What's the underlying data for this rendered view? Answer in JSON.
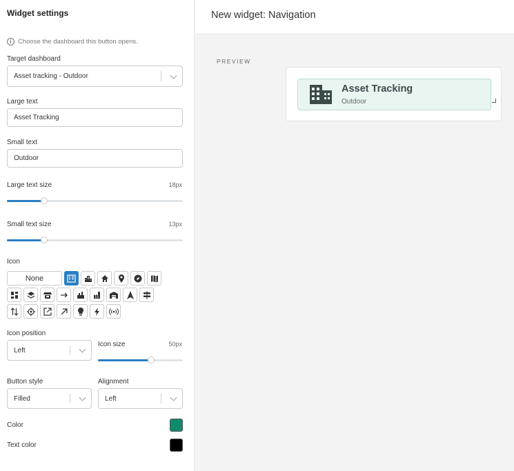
{
  "sidebar": {
    "title": "Widget settings",
    "hint": "Choose the dashboard this button opens.",
    "target_dashboard": {
      "label": "Target dashboard",
      "value": "Asset tracking - Outdoor"
    },
    "large_text": {
      "label": "Large text",
      "value": "Asset Tracking"
    },
    "small_text": {
      "label": "Small text",
      "value": "Outdoor"
    },
    "large_text_size": {
      "label": "Large text size",
      "value": "18px",
      "fraction": 0.21
    },
    "small_text_size": {
      "label": "Small text size",
      "value": "13px",
      "fraction": 0.21
    },
    "icon": {
      "label": "Icon",
      "none_label": "None",
      "selected": "building-icon",
      "rows": [
        [
          "none",
          "building-icon",
          "city-icon",
          "home-icon",
          "map-pin-icon",
          "compass-icon",
          "map-icon"
        ],
        [
          "dashboard-icon",
          "layers-icon",
          "store-icon",
          "arrow-right-icon",
          "factory-icon",
          "industry-icon",
          "warehouse-icon",
          "navigation-icon",
          "signpost-icon"
        ],
        [
          "swap-vertical-icon",
          "target-icon",
          "external-link-icon",
          "arrow-up-right-icon",
          "lightbulb-icon",
          "bolt-icon",
          "broadcast-icon"
        ]
      ]
    },
    "icon_position": {
      "label": "Icon position",
      "value": "Left"
    },
    "icon_size": {
      "label": "Icon size",
      "value": "50px",
      "fraction": 0.63
    },
    "button_style": {
      "label": "Button style",
      "value": "Filled"
    },
    "alignment": {
      "label": "Alignment",
      "value": "Left"
    },
    "color": {
      "label": "Color",
      "value": "#0f8a6b"
    },
    "text_color": {
      "label": "Text color",
      "value": "#000000"
    }
  },
  "main": {
    "title": "New widget: Navigation",
    "preview_label": "PREVIEW",
    "button": {
      "large": "Asset Tracking",
      "small": "Outdoor",
      "icon": "building-icon",
      "bg": "#e9f5f1"
    }
  }
}
